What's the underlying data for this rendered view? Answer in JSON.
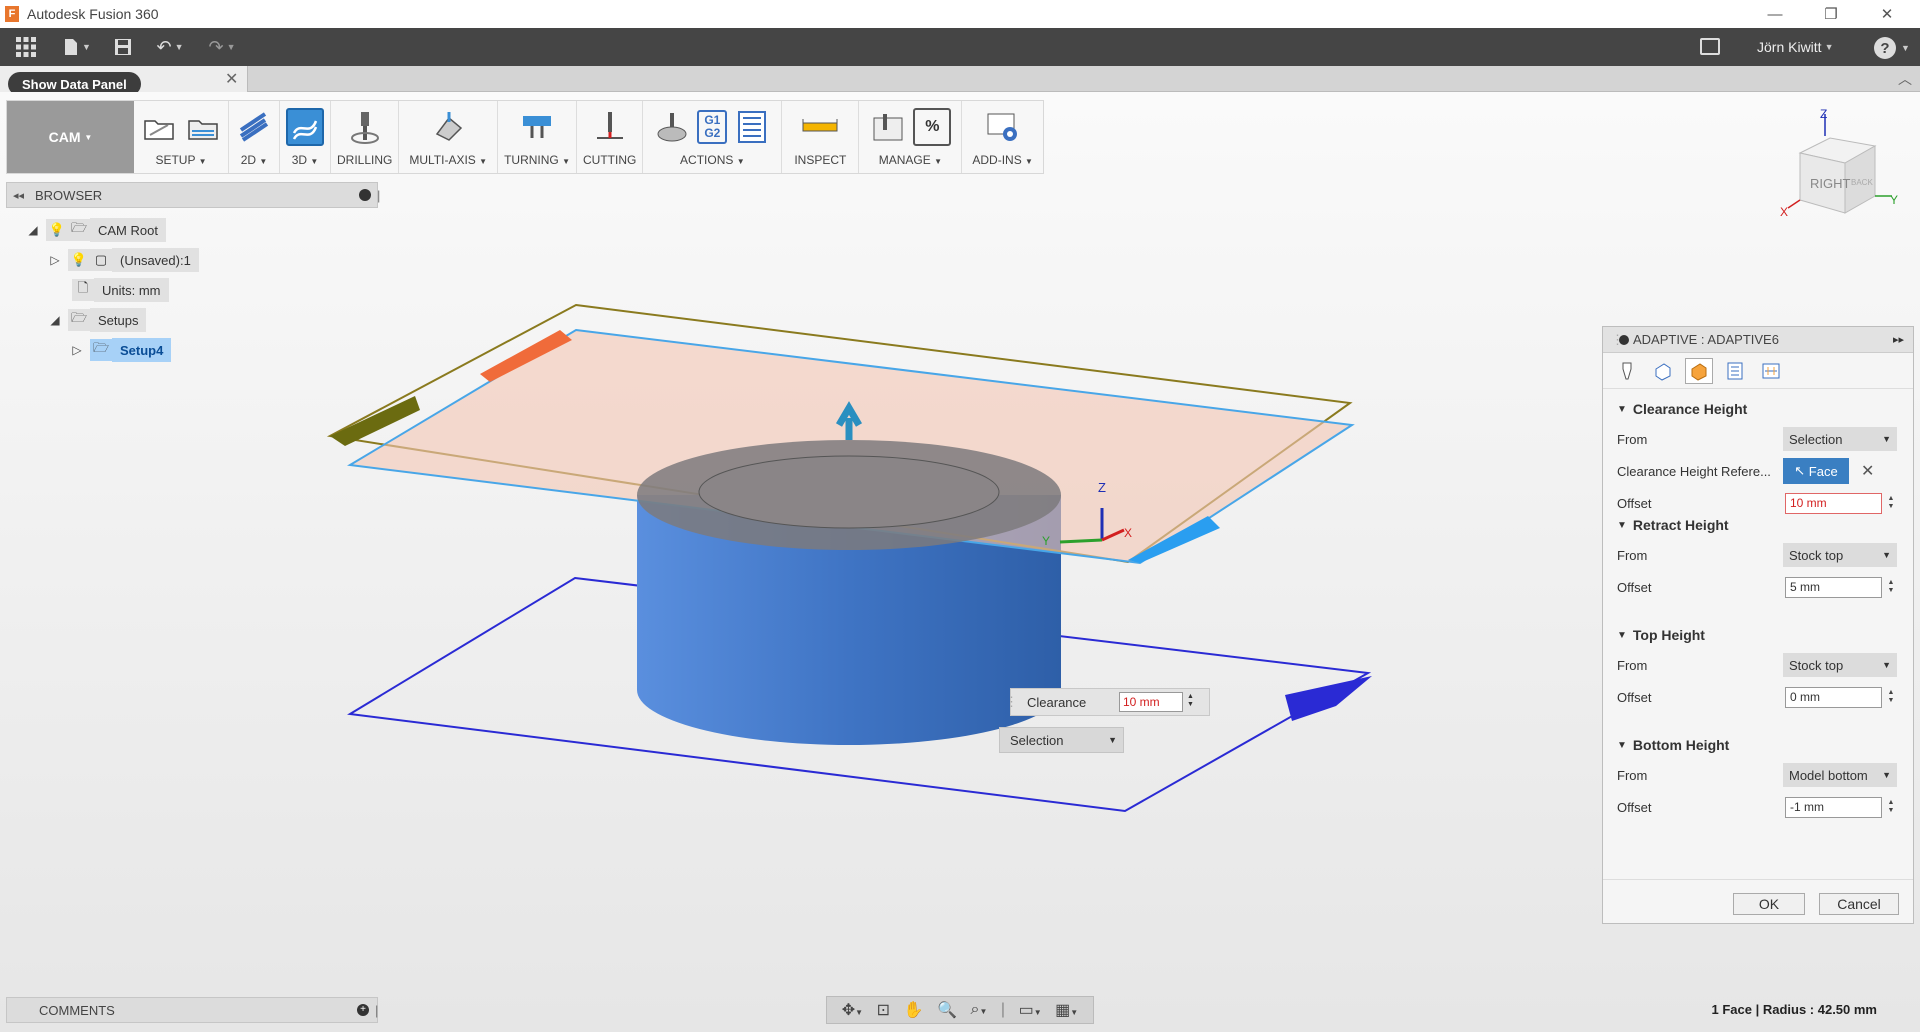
{
  "window": {
    "title": "Autodesk Fusion 360",
    "logo_letter": "F"
  },
  "user": {
    "name": "Jörn Kiwitt",
    "help": "?"
  },
  "data_panel": {
    "button": "Show Data Panel"
  },
  "ribbon": {
    "workspace": "CAM",
    "groups": [
      "SETUP",
      "2D",
      "3D",
      "DRILLING",
      "MULTI-AXIS",
      "TURNING",
      "CUTTING",
      "ACTIONS",
      "INSPECT",
      "MANAGE",
      "ADD-INS"
    ],
    "actions_g1": "G1",
    "actions_g2": "G2",
    "manage_pct": "%"
  },
  "browser": {
    "title": "BROWSER",
    "items": [
      {
        "label": "CAM Root"
      },
      {
        "label": "(Unsaved):1"
      },
      {
        "label": "Units: mm"
      },
      {
        "label": "Setups"
      },
      {
        "label": "Setup4"
      }
    ]
  },
  "viewcube": {
    "face": "RIGHT",
    "back": "BACK",
    "axis_x": "X",
    "axis_y": "Y",
    "axis_z": "Z"
  },
  "triad": {
    "x": "X",
    "y": "Y",
    "z": "Z"
  },
  "hud": {
    "label": "Clearance",
    "value": "10 mm",
    "select": "Selection"
  },
  "panel": {
    "title": "ADAPTIVE : ADAPTIVE6",
    "clearance": {
      "title": "Clearance Height",
      "from_label": "From",
      "from_value": "Selection",
      "ref_label": "Clearance Height Refere...",
      "ref_value": "Face",
      "offset_label": "Offset",
      "offset_value": "10 mm"
    },
    "retract": {
      "title": "Retract Height",
      "from_label": "From",
      "from_value": "Stock top",
      "offset_label": "Offset",
      "offset_value": "5 mm"
    },
    "top": {
      "title": "Top Height",
      "from_label": "From",
      "from_value": "Stock top",
      "offset_label": "Offset",
      "offset_value": "0 mm"
    },
    "bottom": {
      "title": "Bottom Height",
      "from_label": "From",
      "from_value": "Model bottom",
      "offset_label": "Offset",
      "offset_value": "-1 mm"
    },
    "ok": "OK",
    "cancel": "Cancel"
  },
  "comments": {
    "title": "COMMENTS"
  },
  "status": "1 Face | Radius : 42.50 mm",
  "colors": {
    "accent": "#3a8fd6",
    "cylinder": "#3f74c4",
    "clearance_plane": "#f3c6b4",
    "error_text": "#d21f1f"
  }
}
